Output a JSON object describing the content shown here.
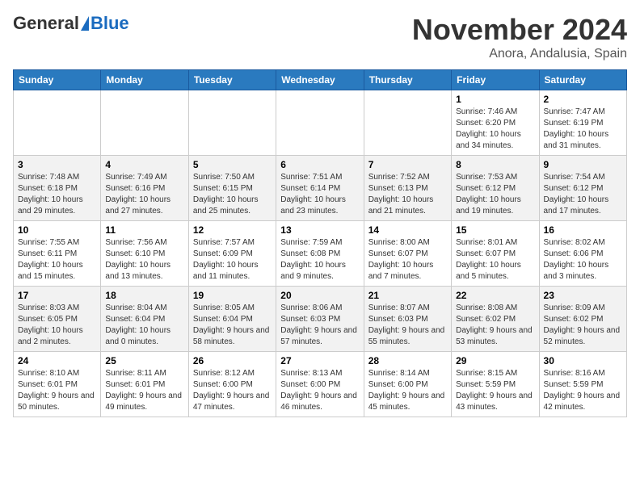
{
  "header": {
    "logo_general": "General",
    "logo_blue": "Blue",
    "month_title": "November 2024",
    "location": "Anora, Andalusia, Spain"
  },
  "days_of_week": [
    "Sunday",
    "Monday",
    "Tuesday",
    "Wednesday",
    "Thursday",
    "Friday",
    "Saturday"
  ],
  "weeks": [
    [
      {
        "day": "",
        "info": ""
      },
      {
        "day": "",
        "info": ""
      },
      {
        "day": "",
        "info": ""
      },
      {
        "day": "",
        "info": ""
      },
      {
        "day": "",
        "info": ""
      },
      {
        "day": "1",
        "info": "Sunrise: 7:46 AM\nSunset: 6:20 PM\nDaylight: 10 hours and 34 minutes."
      },
      {
        "day": "2",
        "info": "Sunrise: 7:47 AM\nSunset: 6:19 PM\nDaylight: 10 hours and 31 minutes."
      }
    ],
    [
      {
        "day": "3",
        "info": "Sunrise: 7:48 AM\nSunset: 6:18 PM\nDaylight: 10 hours and 29 minutes."
      },
      {
        "day": "4",
        "info": "Sunrise: 7:49 AM\nSunset: 6:16 PM\nDaylight: 10 hours and 27 minutes."
      },
      {
        "day": "5",
        "info": "Sunrise: 7:50 AM\nSunset: 6:15 PM\nDaylight: 10 hours and 25 minutes."
      },
      {
        "day": "6",
        "info": "Sunrise: 7:51 AM\nSunset: 6:14 PM\nDaylight: 10 hours and 23 minutes."
      },
      {
        "day": "7",
        "info": "Sunrise: 7:52 AM\nSunset: 6:13 PM\nDaylight: 10 hours and 21 minutes."
      },
      {
        "day": "8",
        "info": "Sunrise: 7:53 AM\nSunset: 6:12 PM\nDaylight: 10 hours and 19 minutes."
      },
      {
        "day": "9",
        "info": "Sunrise: 7:54 AM\nSunset: 6:12 PM\nDaylight: 10 hours and 17 minutes."
      }
    ],
    [
      {
        "day": "10",
        "info": "Sunrise: 7:55 AM\nSunset: 6:11 PM\nDaylight: 10 hours and 15 minutes."
      },
      {
        "day": "11",
        "info": "Sunrise: 7:56 AM\nSunset: 6:10 PM\nDaylight: 10 hours and 13 minutes."
      },
      {
        "day": "12",
        "info": "Sunrise: 7:57 AM\nSunset: 6:09 PM\nDaylight: 10 hours and 11 minutes."
      },
      {
        "day": "13",
        "info": "Sunrise: 7:59 AM\nSunset: 6:08 PM\nDaylight: 10 hours and 9 minutes."
      },
      {
        "day": "14",
        "info": "Sunrise: 8:00 AM\nSunset: 6:07 PM\nDaylight: 10 hours and 7 minutes."
      },
      {
        "day": "15",
        "info": "Sunrise: 8:01 AM\nSunset: 6:07 PM\nDaylight: 10 hours and 5 minutes."
      },
      {
        "day": "16",
        "info": "Sunrise: 8:02 AM\nSunset: 6:06 PM\nDaylight: 10 hours and 3 minutes."
      }
    ],
    [
      {
        "day": "17",
        "info": "Sunrise: 8:03 AM\nSunset: 6:05 PM\nDaylight: 10 hours and 2 minutes."
      },
      {
        "day": "18",
        "info": "Sunrise: 8:04 AM\nSunset: 6:04 PM\nDaylight: 10 hours and 0 minutes."
      },
      {
        "day": "19",
        "info": "Sunrise: 8:05 AM\nSunset: 6:04 PM\nDaylight: 9 hours and 58 minutes."
      },
      {
        "day": "20",
        "info": "Sunrise: 8:06 AM\nSunset: 6:03 PM\nDaylight: 9 hours and 57 minutes."
      },
      {
        "day": "21",
        "info": "Sunrise: 8:07 AM\nSunset: 6:03 PM\nDaylight: 9 hours and 55 minutes."
      },
      {
        "day": "22",
        "info": "Sunrise: 8:08 AM\nSunset: 6:02 PM\nDaylight: 9 hours and 53 minutes."
      },
      {
        "day": "23",
        "info": "Sunrise: 8:09 AM\nSunset: 6:02 PM\nDaylight: 9 hours and 52 minutes."
      }
    ],
    [
      {
        "day": "24",
        "info": "Sunrise: 8:10 AM\nSunset: 6:01 PM\nDaylight: 9 hours and 50 minutes."
      },
      {
        "day": "25",
        "info": "Sunrise: 8:11 AM\nSunset: 6:01 PM\nDaylight: 9 hours and 49 minutes."
      },
      {
        "day": "26",
        "info": "Sunrise: 8:12 AM\nSunset: 6:00 PM\nDaylight: 9 hours and 47 minutes."
      },
      {
        "day": "27",
        "info": "Sunrise: 8:13 AM\nSunset: 6:00 PM\nDaylight: 9 hours and 46 minutes."
      },
      {
        "day": "28",
        "info": "Sunrise: 8:14 AM\nSunset: 6:00 PM\nDaylight: 9 hours and 45 minutes."
      },
      {
        "day": "29",
        "info": "Sunrise: 8:15 AM\nSunset: 5:59 PM\nDaylight: 9 hours and 43 minutes."
      },
      {
        "day": "30",
        "info": "Sunrise: 8:16 AM\nSunset: 5:59 PM\nDaylight: 9 hours and 42 minutes."
      }
    ]
  ]
}
